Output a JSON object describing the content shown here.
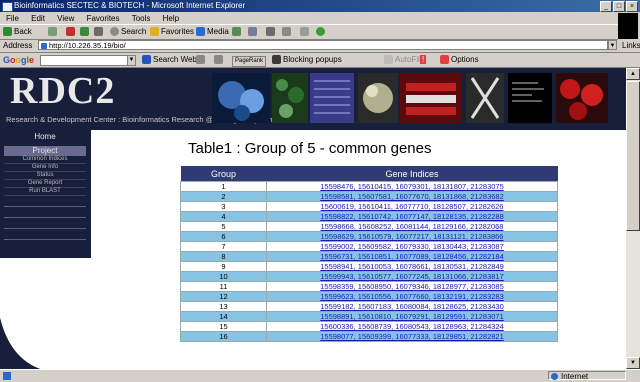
{
  "window": {
    "title": "Bioinformatics SECTEC & BIOTECH - Microsoft Internet Explorer",
    "buttons": [
      "_",
      "□",
      "×"
    ]
  },
  "menu": [
    "File",
    "Edit",
    "View",
    "Favorites",
    "Tools",
    "Help"
  ],
  "toolbar": {
    "back": "Back",
    "search": "Search",
    "favorites": "Favorites",
    "media": "Media"
  },
  "address": {
    "label": "Address",
    "url": "http://10.226.35.19/bio/",
    "links": "Links"
  },
  "googlebar": {
    "logo": [
      "G",
      "o",
      "o",
      "g",
      "l",
      "e"
    ],
    "search_web": "Search Web",
    "pagerank": "PageRank",
    "blocking": "Blocking popups",
    "autofill": "AutoFill",
    "options": "Options"
  },
  "site": {
    "logo": "RDC2",
    "subtitle": "Research & Development Center : Bioinformatics Research @ Intelligent Systems",
    "nav_home": "Home",
    "nav_project": "Project",
    "nav_items": [
      "Common Indices",
      "Gene Info",
      "Status",
      "Gene Report",
      "Run BLAST"
    ],
    "nav_empty_count_label": ""
  },
  "table": {
    "title": "Table1 : Group of 5 - common genes",
    "headers": [
      "Group",
      "Gene Indices"
    ],
    "rows": [
      [
        "1",
        "15598476, 15610415, 16079301, 18131807, 21283075"
      ],
      [
        "2",
        "15598581, 15607581, 16077670, 18131868, 21283682"
      ],
      [
        "3",
        "15600619, 15610411, 16077710, 18128507, 21282626"
      ],
      [
        "4",
        "15598822, 15610742, 16077147, 18128135, 21282288"
      ],
      [
        "5",
        "15598668, 15608252, 16081144, 18129166, 21282068"
      ],
      [
        "6",
        "15598629, 15610579, 16077217, 18131121, 21283866"
      ],
      [
        "7",
        "15599002, 15609582, 16079330, 18130443, 21283087"
      ],
      [
        "8",
        "15596731, 15610851, 16077089, 18128456, 21282184"
      ],
      [
        "9",
        "15598941, 15610053, 16078661, 18130531, 21282849"
      ],
      [
        "10",
        "15599943, 15610577, 16077245, 18131066, 21283817"
      ],
      [
        "11",
        "15598359, 15608950, 16079346, 18128977, 21283085"
      ],
      [
        "12",
        "15599623, 15610556, 16077660, 18132191, 21283283"
      ],
      [
        "13",
        "15599182, 15607183, 16080084, 18128625, 21283430"
      ],
      [
        "14",
        "15598891, 15610810, 16079291, 18129591, 21283071"
      ],
      [
        "15",
        "15600336, 15608739, 16080543, 18128963, 21284324"
      ],
      [
        "16",
        "15598077, 15609399, 16077333, 18129851, 21282821"
      ]
    ]
  },
  "status": {
    "zone": "Internet"
  },
  "colors": {
    "banner": "#171f3a",
    "row_alt": "#87c4e4",
    "table_header": "#303a74",
    "link": "#1a1ab0"
  }
}
